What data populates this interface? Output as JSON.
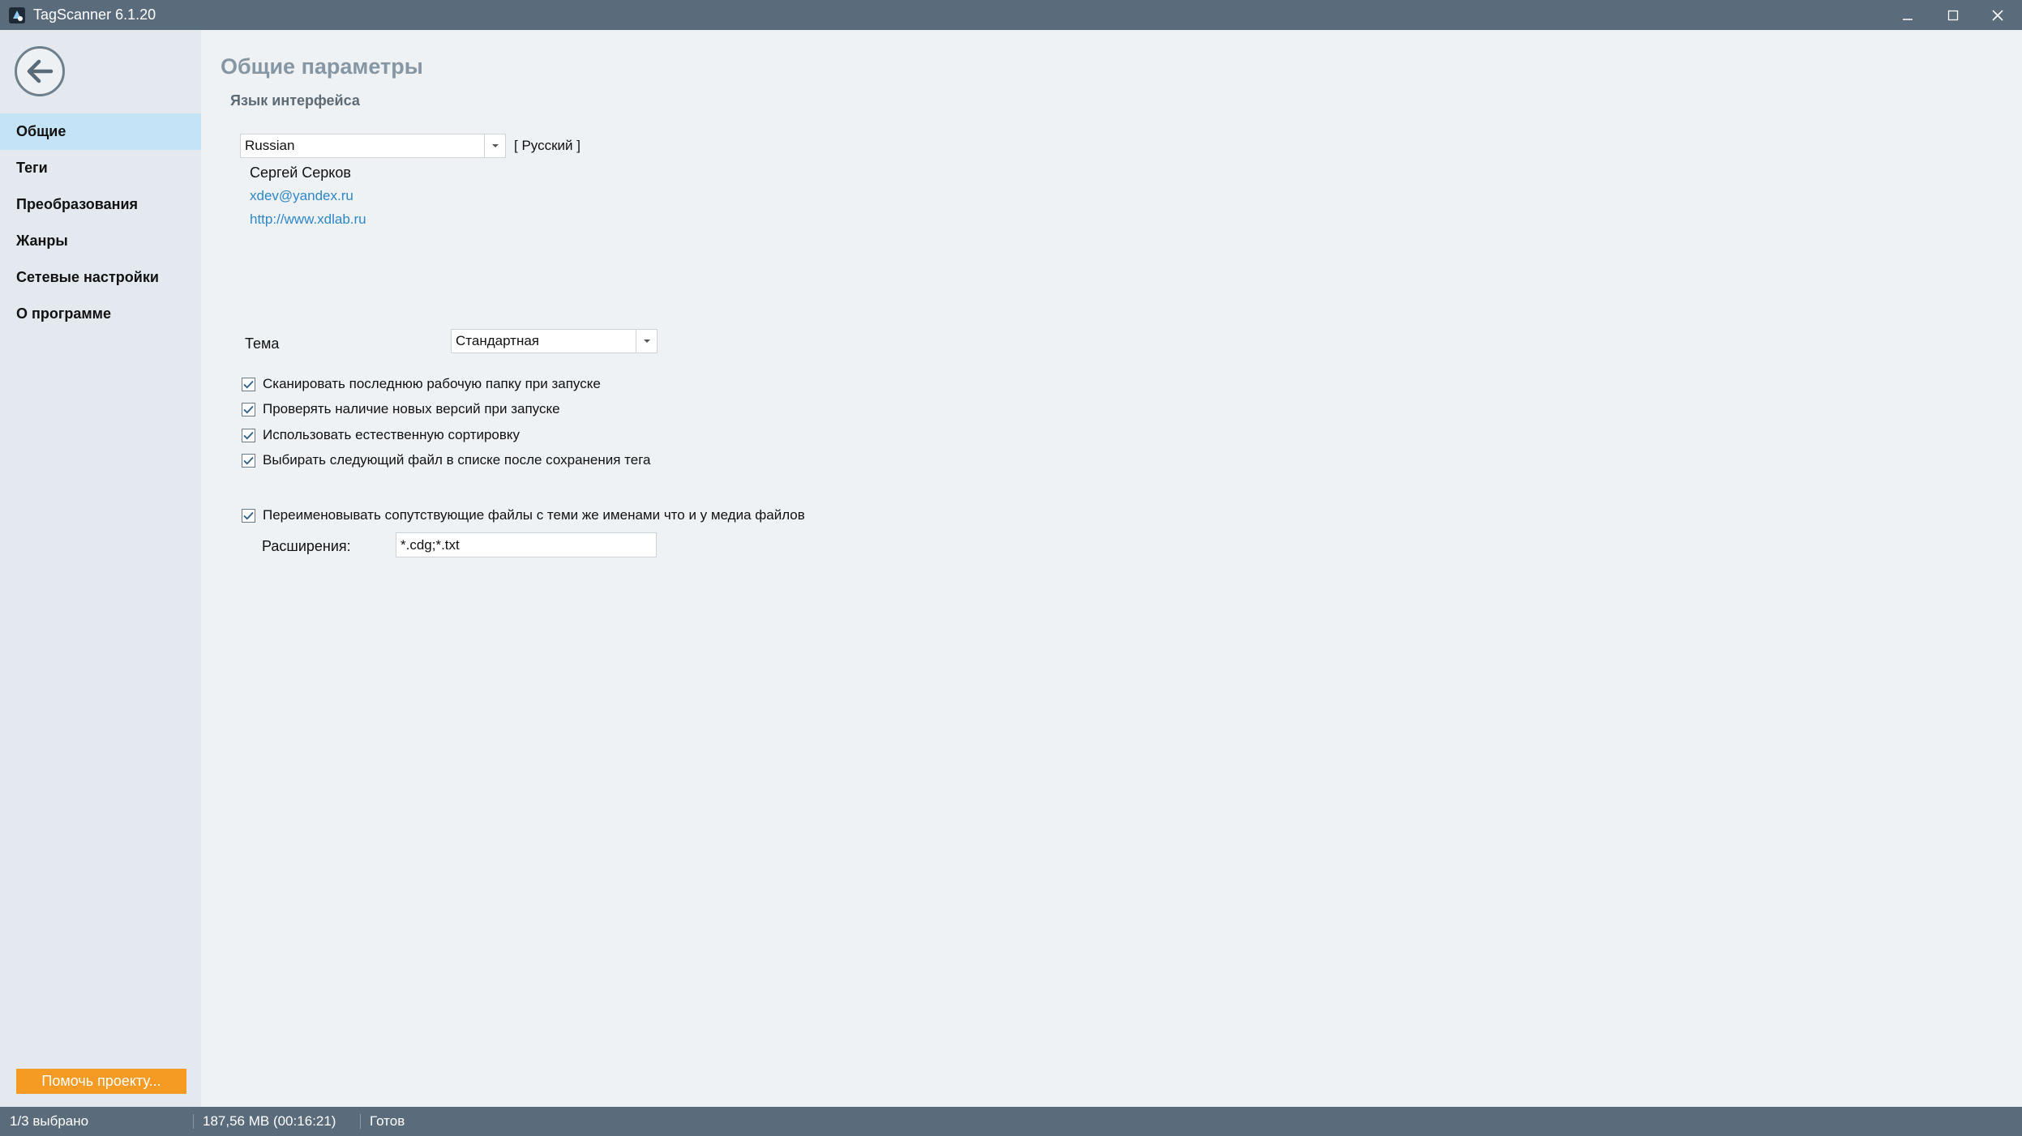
{
  "window": {
    "title": "TagScanner 6.1.20",
    "controls": [
      "minimize",
      "maximize",
      "close"
    ]
  },
  "sidebar": {
    "back_icon": "arrow-left-icon",
    "items": [
      {
        "label": "Общие",
        "active": true
      },
      {
        "label": "Теги",
        "active": false
      },
      {
        "label": "Преобразования",
        "active": false
      },
      {
        "label": "Жанры",
        "active": false
      },
      {
        "label": "Сетевые настройки",
        "active": false
      },
      {
        "label": "О программе",
        "active": false
      }
    ],
    "help_button": "Помочь проекту..."
  },
  "main": {
    "title": "Общие параметры",
    "language_section": "Язык интерфейса",
    "language_value": "Russian",
    "language_native": "[ Русский ]",
    "translator_name": "Сергей Серков",
    "translator_email": "xdev@yandex.ru",
    "translator_site": "http://www.xdlab.ru",
    "theme_label": "Тема",
    "theme_value": "Стандартная",
    "options": [
      {
        "label": "Сканировать последнюю рабочую папку при запуске",
        "checked": true
      },
      {
        "label": "Проверять наличие новых версий при запуске",
        "checked": true
      },
      {
        "label": "Использовать естественную сортировку",
        "checked": true
      },
      {
        "label": "Выбирать следующий файл в списке после сохранения тега",
        "checked": true
      }
    ],
    "rename_option": {
      "label": "Переименовывать сопутствующие файлы с теми же именами что и у медиа файлов",
      "checked": true
    },
    "extensions_label": "Расширения:",
    "extensions_value": "*.cdg;*.txt"
  },
  "statusbar": {
    "selection": "1/3 выбрано",
    "size": "187,56 MB (00:16:21)",
    "state": "Готов"
  },
  "colors": {
    "titlebar": "#5a6b7b",
    "sidebar": "#e3e9ee",
    "active_item": "#c5e3f7",
    "accent_orange": "#f59a23",
    "link": "#2e86c9"
  }
}
